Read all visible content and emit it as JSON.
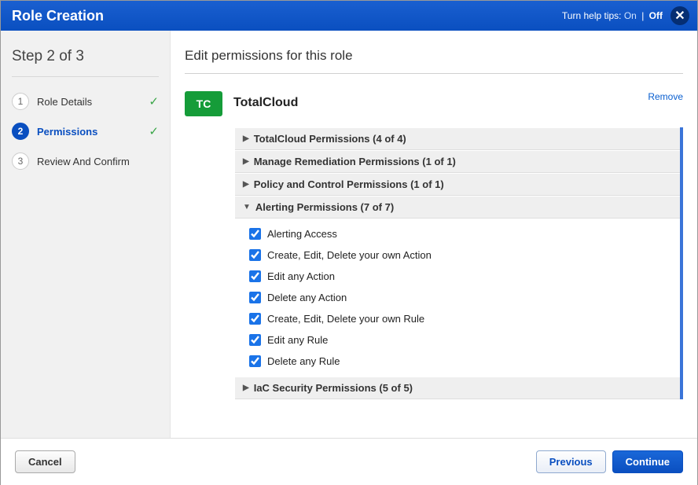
{
  "title": "Role Creation",
  "helpTips": {
    "label": "Turn help tips:",
    "on": "On",
    "off": "Off",
    "sep": "|"
  },
  "stepHead": "Step 2 of 3",
  "steps": [
    {
      "num": "1",
      "label": "Role Details",
      "done": true,
      "active": false
    },
    {
      "num": "2",
      "label": "Permissions",
      "done": true,
      "active": true
    },
    {
      "num": "3",
      "label": "Review And Confirm",
      "done": false,
      "active": false
    }
  ],
  "mainTitle": "Edit permissions for this role",
  "module": {
    "badge": "TC",
    "name": "TotalCloud",
    "removeLabel": "Remove"
  },
  "groups": [
    {
      "label": "TotalCloud Permissions (4 of 4)",
      "expanded": false
    },
    {
      "label": "Manage Remediation Permissions (1 of 1)",
      "expanded": false
    },
    {
      "label": "Policy and Control Permissions (1 of 1)",
      "expanded": false
    },
    {
      "label": "Alerting Permissions (7 of 7)",
      "expanded": true,
      "items": [
        {
          "label": "Alerting Access",
          "checked": true
        },
        {
          "label": "Create, Edit, Delete your own Action",
          "checked": true
        },
        {
          "label": "Edit any Action",
          "checked": true
        },
        {
          "label": "Delete any Action",
          "checked": true
        },
        {
          "label": "Create, Edit, Delete your own Rule",
          "checked": true
        },
        {
          "label": "Edit any Rule",
          "checked": true
        },
        {
          "label": "Delete any Rule",
          "checked": true
        }
      ]
    },
    {
      "label": "IaC Security Permissions (5 of 5)",
      "expanded": false
    }
  ],
  "buttons": {
    "cancel": "Cancel",
    "previous": "Previous",
    "continue": "Continue"
  }
}
